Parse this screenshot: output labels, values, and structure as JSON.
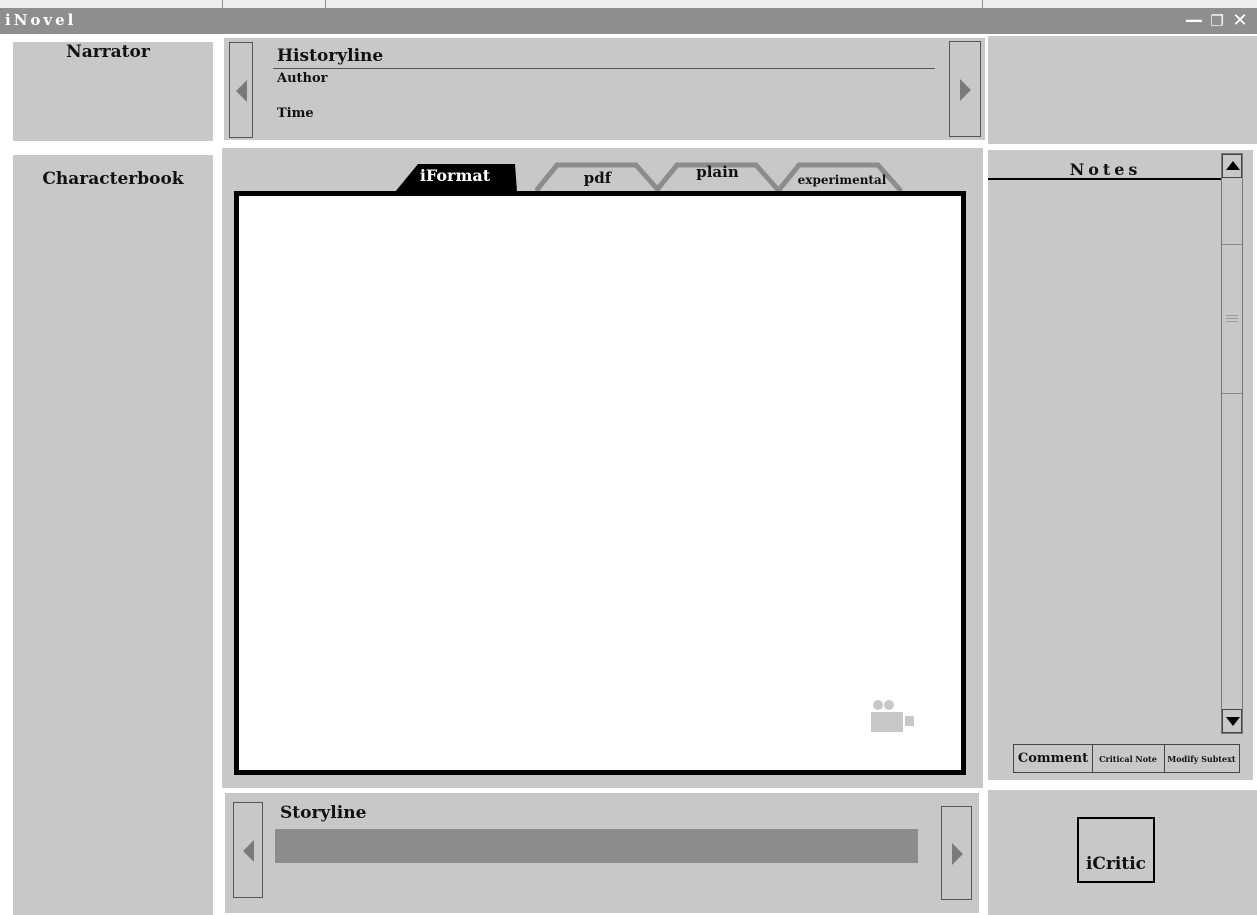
{
  "window": {
    "title": "iNovel",
    "minimize": "—",
    "restore": "❐",
    "close": "✕"
  },
  "narrator": {
    "label": "Narrator"
  },
  "historyline": {
    "title": "Historyline",
    "author_label": "Author",
    "time_label": "Time"
  },
  "characterbook": {
    "label": "Characterbook"
  },
  "tabs": [
    {
      "label": "iFormat",
      "active": true
    },
    {
      "label": "pdf",
      "active": false
    },
    {
      "label": "plain",
      "active": false
    },
    {
      "label": "experimental",
      "active": false
    }
  ],
  "notes": {
    "title": "Notes",
    "buttons": {
      "comment": "Comment",
      "critical_note": "Critical Note",
      "modify_subtext": "Modify Subtext"
    }
  },
  "storyline": {
    "title": "Storyline"
  },
  "icritic": {
    "label": "iCritic"
  },
  "colors": {
    "titlebar": "#8e8e8e",
    "panel": "#c8c8c8",
    "storyline_bar": "#8c8c8c",
    "editor_border": "#000000"
  }
}
